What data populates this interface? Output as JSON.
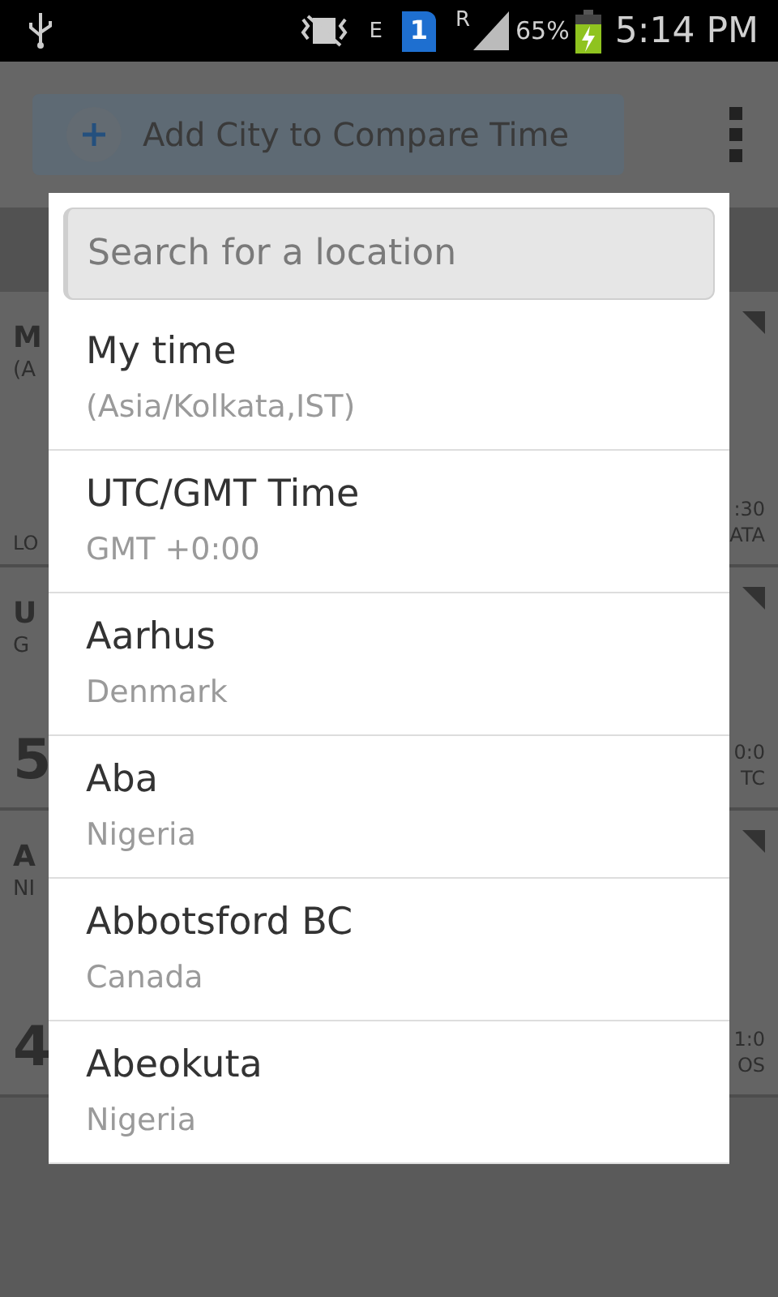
{
  "status_bar": {
    "network_type": "E",
    "sim": "1",
    "roaming": "R",
    "battery": "65%",
    "time": "5:14 PM"
  },
  "toolbar": {
    "add_button": "Add City to Compare Time"
  },
  "background_cards": [
    {
      "title": "M",
      "subtitle": "(A",
      "footer": "LO",
      "offset": ":30",
      "zone": "ATA"
    },
    {
      "title": "U",
      "subtitle": "G",
      "big_time": "5",
      "offset": "0:0",
      "zone": "TC"
    },
    {
      "title": "A",
      "subtitle": "NI",
      "big_time": "4",
      "offset": "1:0",
      "zone": "OS"
    }
  ],
  "dialog": {
    "search": {
      "placeholder": "Search for a location"
    },
    "items": [
      {
        "name": "My time",
        "detail": "(Asia/Kolkata,IST)"
      },
      {
        "name": "UTC/GMT Time",
        "detail": "GMT +0:00"
      },
      {
        "name": "Aarhus",
        "detail": "Denmark"
      },
      {
        "name": "Aba",
        "detail": "Nigeria"
      },
      {
        "name": "Abbotsford BC",
        "detail": "Canada"
      },
      {
        "name": "Abeokuta",
        "detail": "Nigeria"
      }
    ]
  }
}
